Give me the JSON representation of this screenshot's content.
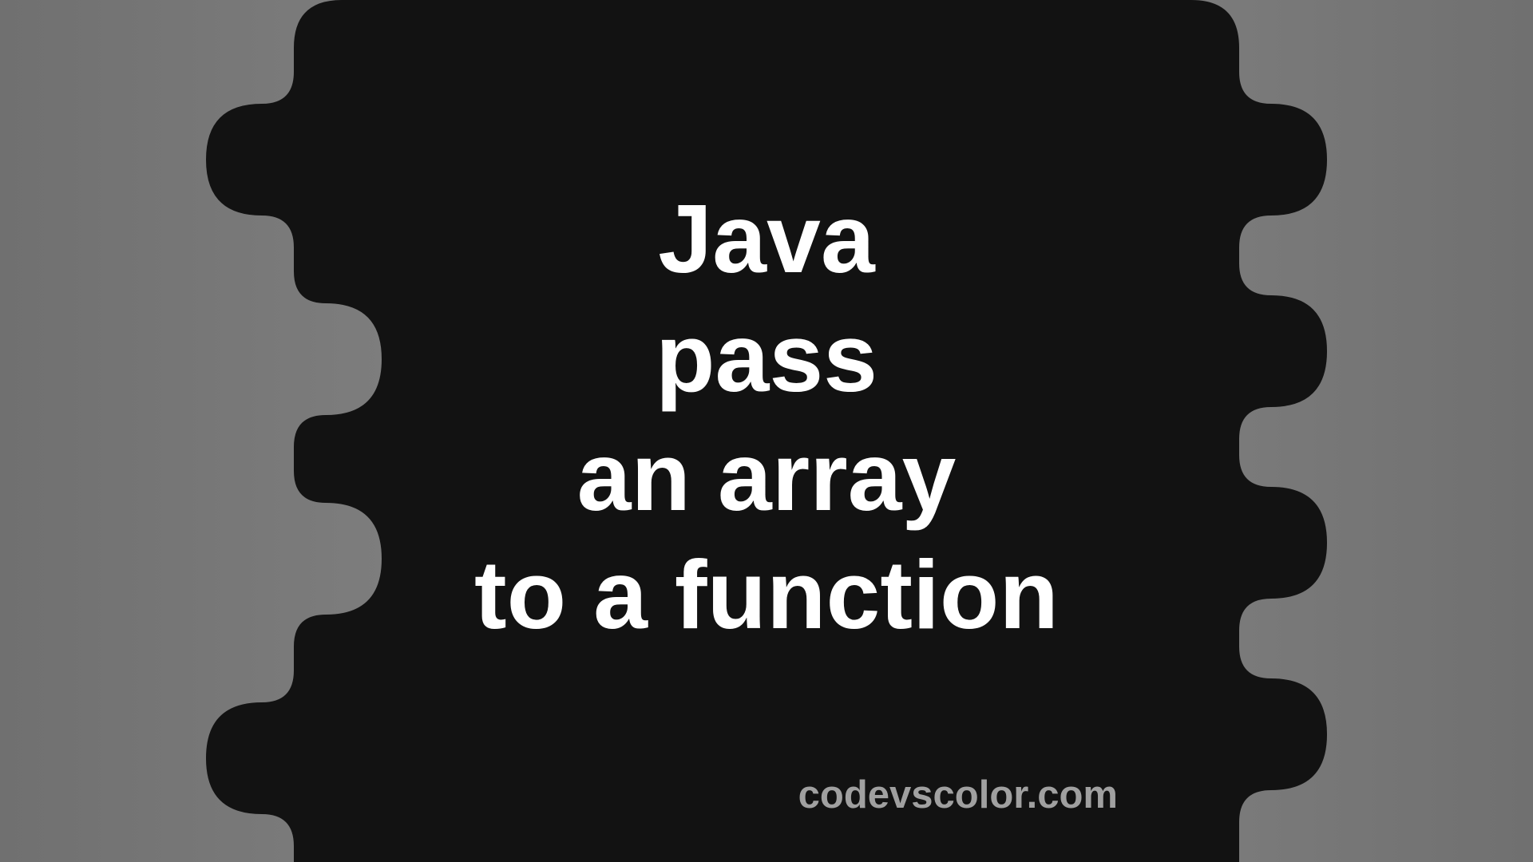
{
  "title": {
    "line1": "Java",
    "line2": "pass",
    "line3": "an array",
    "line4": "to a function"
  },
  "watermark": "codevscolor.com",
  "colors": {
    "blob": "#121212",
    "text": "#ffffff",
    "watermark": "#a0a0a0",
    "bgGrayLight": "#8a8a8a",
    "bgGrayDark": "#707070"
  }
}
